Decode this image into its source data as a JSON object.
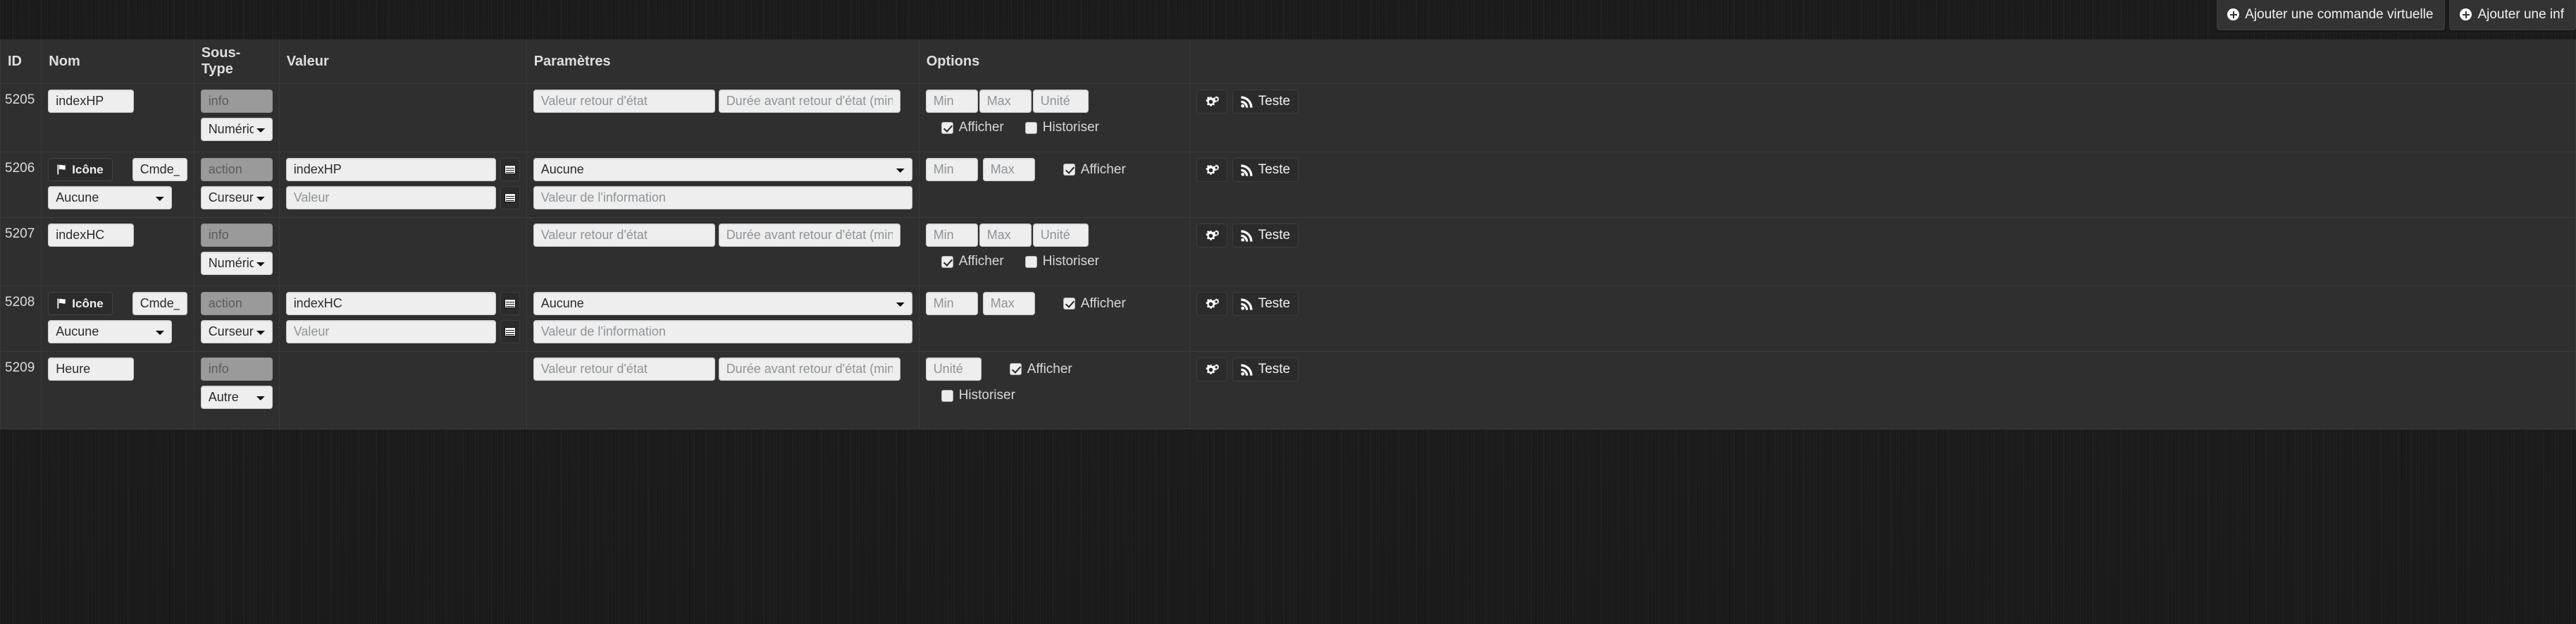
{
  "topbar": {
    "buttons": [
      {
        "label": "Ajouter une commande virtuelle",
        "icon": "plus-circle-icon"
      },
      {
        "label": "Ajouter une inf",
        "icon": "plus-circle-icon"
      }
    ]
  },
  "table": {
    "headers": {
      "id": "ID",
      "nom": "Nom",
      "sous_type": "Sous-Type",
      "valeur": "Valeur",
      "parametres": "Paramètres",
      "options": "Options",
      "actions": ""
    },
    "placeholders": {
      "sous_type_info": "info",
      "sous_type_action": "action",
      "valeur": "Valeur",
      "valeur_retour_etat": "Valeur retour d'état",
      "duree_avant_retour": "Durée avant retour d'état (min)",
      "valeur_information": "Valeur de l'information",
      "min": "Min",
      "max": "Max",
      "unite": "Unité"
    },
    "labels": {
      "afficher": "Afficher",
      "historiser": "Historiser",
      "icone": "Icône",
      "tester": "Teste"
    },
    "rows": [
      {
        "id": "5205",
        "kind": "info",
        "nom_value": "indexHP",
        "sous_type_placeholder": "info",
        "sous_type_select": "Numérique",
        "valeur_value": "",
        "param_a": "",
        "param_b": "",
        "min": "",
        "max": "",
        "unite": "",
        "afficher": true,
        "historiser": false,
        "has_minmax": true,
        "has_unite": true
      },
      {
        "id": "5206",
        "kind": "action",
        "icone_label": "Icône",
        "nom_value": "Cmde_indexH",
        "nom_select": "Aucune",
        "sous_type_placeholder": "action",
        "sous_type_select": "Curseur",
        "valeur_value": "indexHP",
        "valeur_placeholder2": "Valeur",
        "param_select": "Aucune",
        "param_info_placeholder": "Valeur de l'information",
        "min": "",
        "max": "",
        "afficher": true,
        "has_minmax": true,
        "has_unite": false
      },
      {
        "id": "5207",
        "kind": "info",
        "nom_value": "indexHC",
        "sous_type_placeholder": "info",
        "sous_type_select": "Numérique",
        "valeur_value": "",
        "param_a": "",
        "param_b": "",
        "min": "",
        "max": "",
        "unite": "",
        "afficher": true,
        "historiser": false,
        "has_minmax": true,
        "has_unite": true
      },
      {
        "id": "5208",
        "kind": "action",
        "icone_label": "Icône",
        "nom_value": "Cmde_indexH",
        "nom_select": "Aucune",
        "sous_type_placeholder": "action",
        "sous_type_select": "Curseur",
        "valeur_value": "indexHC",
        "valeur_placeholder2": "Valeur",
        "param_select": "Aucune",
        "param_info_placeholder": "Valeur de l'information",
        "min": "",
        "max": "",
        "afficher": true,
        "has_minmax": true,
        "has_unite": false
      },
      {
        "id": "5209",
        "kind": "info",
        "nom_value": "Heure",
        "sous_type_placeholder": "info",
        "sous_type_select": "Autre",
        "valeur_value": "",
        "param_a": "",
        "param_b": "",
        "unite": "",
        "afficher": true,
        "historiser": false,
        "has_minmax": false,
        "has_unite": true
      }
    ]
  },
  "colors": {
    "page_bg": "#1b1b1b",
    "cell_bg": "#2f2f2f",
    "border": "#3a3a3a",
    "field_bg": "#eeeeee",
    "field_disabled_bg": "#9a9a9a",
    "text": "#e6e6e6",
    "button_bg": "#2b2b2b"
  }
}
